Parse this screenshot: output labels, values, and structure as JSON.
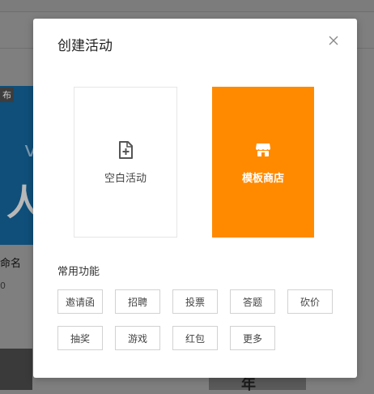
{
  "background": {
    "card_tag": "布",
    "card_name": "命名",
    "card_count": "0",
    "card_char": "人",
    "bottom_char": "年"
  },
  "modal": {
    "title": "创建活动",
    "close_icon": "close-icon",
    "options": [
      {
        "label": "空白活动",
        "icon": "file-plus-icon"
      },
      {
        "label": "模板商店",
        "icon": "store-icon"
      }
    ],
    "features_title": "常用功能",
    "features": [
      "邀请函",
      "招聘",
      "投票",
      "答题",
      "砍价",
      "抽奖",
      "游戏",
      "红包",
      "更多"
    ]
  },
  "colors": {
    "accent": "#ff8a00",
    "overlay": "#7f7f7f",
    "card_border": "#e6e6e6",
    "button_border": "#d2d2d2"
  }
}
